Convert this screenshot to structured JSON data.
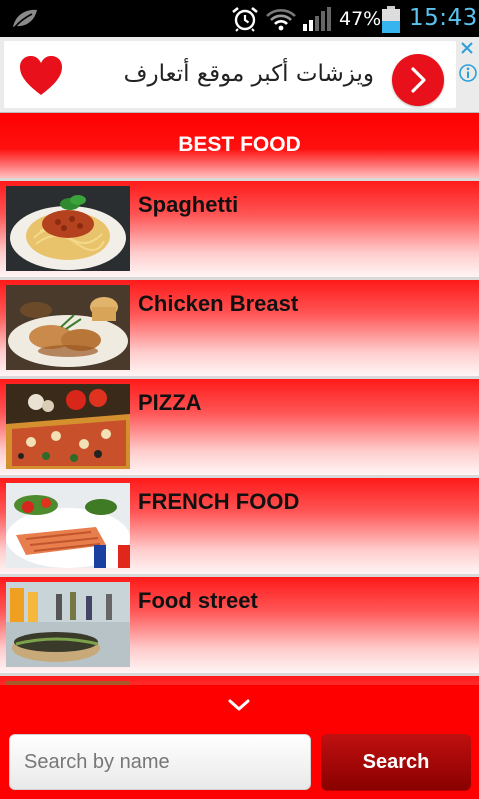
{
  "status_bar": {
    "battery_percent": "47%",
    "time": "15:43",
    "icons": [
      "leaf-icon",
      "alarm-icon",
      "wifi-icon",
      "signal-icon",
      "battery-icon"
    ]
  },
  "ad": {
    "text": "ويزشات أكبر موقع أتعارف",
    "icons": [
      "heart-icon",
      "chevron-right-icon",
      "close-icon",
      "info-icon"
    ]
  },
  "header": {
    "title": "BEST FOOD"
  },
  "list": {
    "items": [
      {
        "label": "Spaghetti"
      },
      {
        "label": "Chicken Breast"
      },
      {
        "label": "PIZZA"
      },
      {
        "label": "FRENCH FOOD"
      },
      {
        "label": "Food street"
      },
      {
        "label": ""
      }
    ]
  },
  "search": {
    "placeholder": "Search by name",
    "button_label": "Search"
  },
  "colors": {
    "primary_red": "#ff0000",
    "button_dark_red": "#a00000",
    "clock_blue": "#5cc3f0"
  }
}
